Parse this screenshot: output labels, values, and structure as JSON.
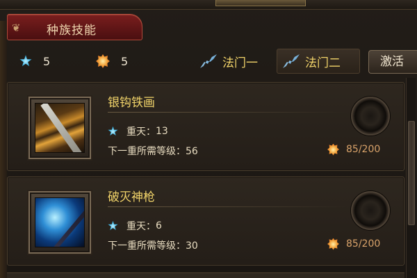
{
  "header": {
    "title": "种族技能"
  },
  "resources": {
    "blue_star_count": "5",
    "orange_star_count": "5"
  },
  "tabs": [
    {
      "label": "法门一",
      "icon": "fa-swoosh-icon"
    },
    {
      "label": "法门二",
      "icon": "fa-swoosh-icon"
    }
  ],
  "activate_label": "激活",
  "skills": [
    {
      "name": "银钩铁画",
      "level_label": "重天：",
      "level": "13",
      "requirement_label": "下一重所需等级：",
      "requirement": "56",
      "cost": "85/200",
      "icon": "gold-claw-skill-icon"
    },
    {
      "name": "破灭神枪",
      "level_label": "重天：",
      "level": "6",
      "requirement_label": "下一重所需等级：",
      "requirement": "30",
      "cost": "85/200",
      "icon": "blue-spear-skill-icon"
    }
  ],
  "colors": {
    "skill_name": "#f2d46a",
    "tab_title_bg": "#7a1e1e",
    "cost_text": "#d9a36a"
  }
}
